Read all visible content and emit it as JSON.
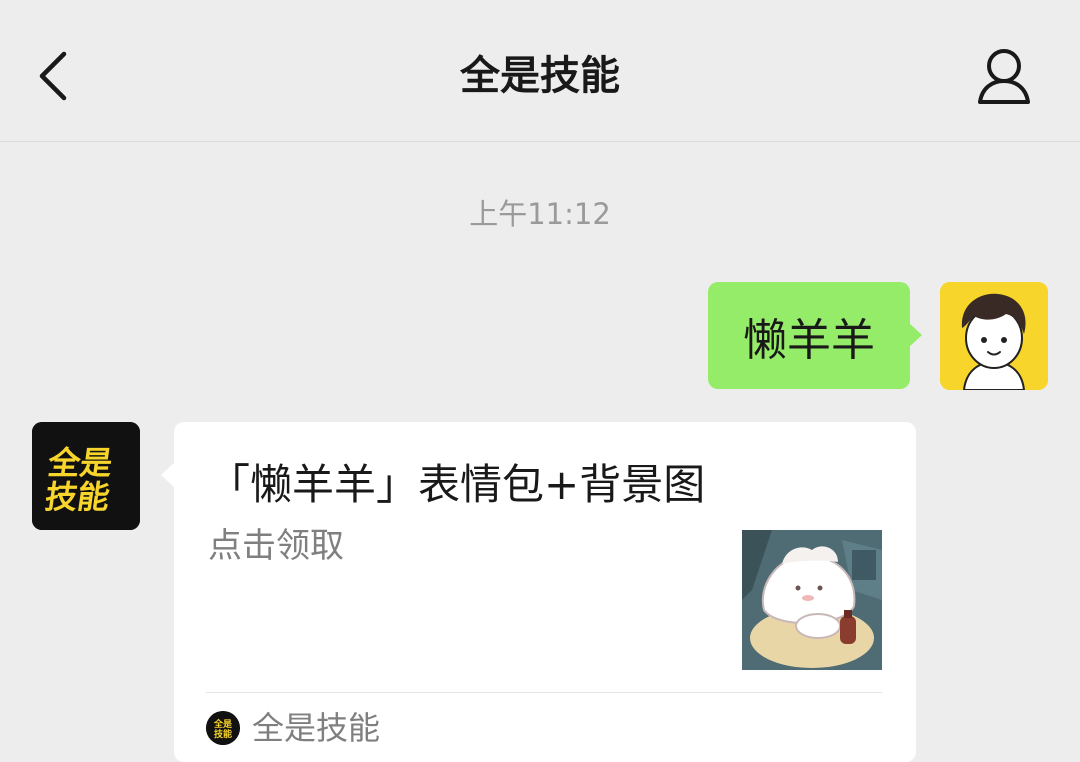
{
  "header": {
    "title": "全是技能",
    "back_icon": "chevron-left-icon",
    "profile_icon": "person-icon"
  },
  "chat": {
    "timestamp": "上午11:12",
    "outgoing_message": "懒羊羊",
    "card": {
      "title": "「懒羊羊」表情包+背景图",
      "description": "点击领取",
      "source": "全是技能"
    },
    "official_avatar_text": [
      "全是",
      "技能"
    ]
  },
  "colors": {
    "background": "#ededed",
    "outgoing_bubble": "#95ec69",
    "card": "#ffffff",
    "brand_yellow": "#f7d52b"
  }
}
